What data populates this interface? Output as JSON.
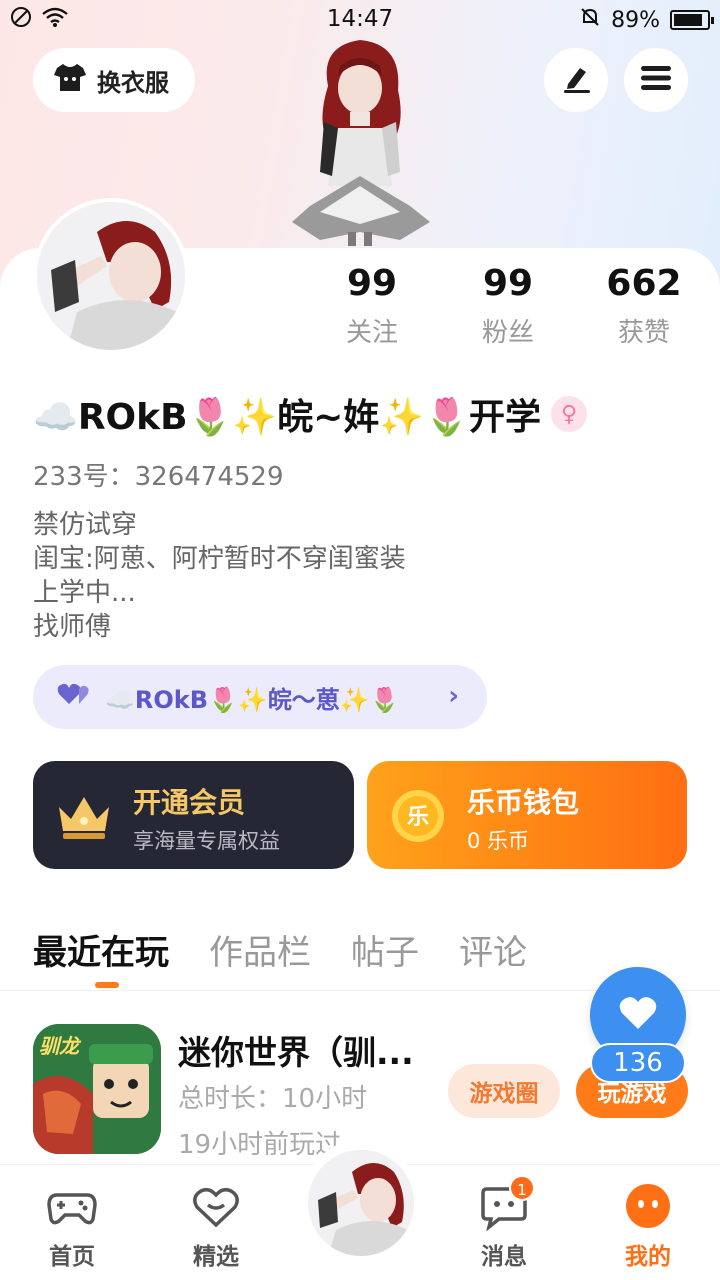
{
  "status_bar": {
    "time": "14:47",
    "battery_text": "89%",
    "battery_level": 0.89
  },
  "header": {
    "outfit_label": "换衣服"
  },
  "profile": {
    "stats": [
      {
        "value": "99",
        "label": "关注"
      },
      {
        "value": "99",
        "label": "粉丝"
      },
      {
        "value": "662",
        "label": "获赞"
      }
    ],
    "username": "☁️ROkB🌷✨皖~姩✨🌷开学",
    "gender_symbol": "♀",
    "uid": "233号：326474529",
    "bio_lines": [
      "禁仿试穿",
      "闺宝:阿葸、阿柠暂时不穿闺蜜装",
      "上学中...",
      "找师傅"
    ],
    "fan_pill_text": "☁️ROkB🌷✨皖～葸✨🌷"
  },
  "cards": {
    "vip": {
      "title": "开通会员",
      "subtitle": "享海量专属权益"
    },
    "wallet": {
      "title": "乐币钱包",
      "subtitle": "0 乐币",
      "coin_char": "乐"
    }
  },
  "tabs": [
    {
      "label": "最近在玩",
      "active": true
    },
    {
      "label": "作品栏",
      "active": false
    },
    {
      "label": "帖子",
      "active": false
    },
    {
      "label": "评论",
      "active": false
    }
  ],
  "game": {
    "title": "迷你世界（驯...",
    "duration": "总时长：10小时",
    "last_played": "19小时前玩过",
    "circle_btn": "游戏圈",
    "play_btn": "玩游戏",
    "icon_text": "驯龙"
  },
  "like_float": {
    "count": "136"
  },
  "bottom_nav": [
    {
      "label": "首页",
      "icon": "gamepad-icon",
      "active": false
    },
    {
      "label": "精选",
      "icon": "heart-badge-icon",
      "active": false
    },
    {
      "label": "消息",
      "icon": "chat-icon",
      "active": false,
      "badge": "1"
    },
    {
      "label": "我的",
      "icon": "face-icon",
      "active": true
    }
  ],
  "colors": {
    "accent": "#ff6f14",
    "vip_bg": "#262735",
    "like_blue": "#3d8ff0",
    "fan_pill_bg": "#ecebfb"
  }
}
